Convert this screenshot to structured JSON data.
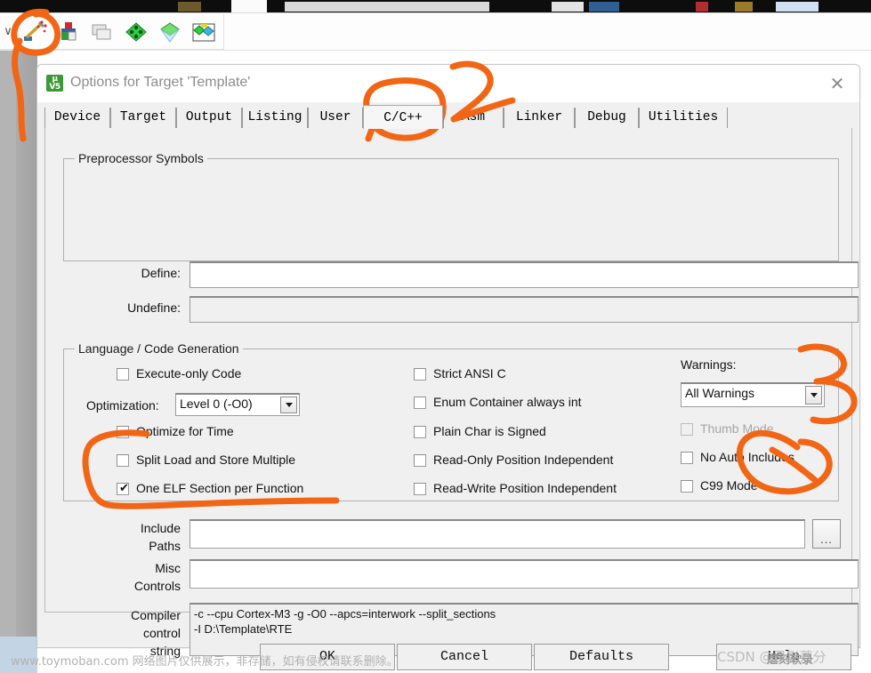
{
  "window": {
    "title": "Options for Target 'Template'",
    "icon_line1": "μ",
    "icon_line2": "V5",
    "close_label": "✕"
  },
  "toolbar": {
    "chevron": "∨",
    "icons": [
      {
        "name": "rebuild-target-icon",
        "label": "rebuild"
      },
      {
        "name": "batch-build-icon",
        "label": "batch build"
      },
      {
        "name": "stop-build-icon",
        "label": "stop build"
      },
      {
        "name": "options-for-target-icon",
        "label": "options for target"
      },
      {
        "name": "manage-project-items-icon",
        "label": "manage project items"
      },
      {
        "name": "manage-runtime-environment-icon",
        "label": "manage run-time environment"
      }
    ]
  },
  "tabs": [
    {
      "label": "Device",
      "selected": false
    },
    {
      "label": "Target",
      "selected": false
    },
    {
      "label": "Output",
      "selected": false
    },
    {
      "label": "Listing",
      "selected": false
    },
    {
      "label": "User",
      "selected": false
    },
    {
      "label": "C/C++",
      "selected": true
    },
    {
      "label": "Asm",
      "selected": false
    },
    {
      "label": "Linker",
      "selected": false
    },
    {
      "label": "Debug",
      "selected": false
    },
    {
      "label": "Utilities",
      "selected": false
    }
  ],
  "preprocessor": {
    "legend": "Preprocessor Symbols",
    "define_label": "Define:",
    "define_value": "",
    "define_placeholder": "",
    "undefine_label": "Undefine:",
    "undefine_value": "",
    "undefine_placeholder": ""
  },
  "language": {
    "legend": "Language / Code Generation",
    "col1": [
      {
        "label": "Execute-only Code",
        "checked": false,
        "enabled": true
      },
      {
        "label": "Optimize for Time",
        "checked": false,
        "enabled": true
      },
      {
        "label": "Split Load and Store Multiple",
        "checked": false,
        "enabled": true
      },
      {
        "label": "One ELF Section per Function",
        "checked": true,
        "enabled": true
      }
    ],
    "optimization_label": "Optimization:",
    "optimization_value": "Level 0 (-O0)",
    "col2": [
      {
        "label": "Strict ANSI C",
        "checked": false,
        "enabled": true
      },
      {
        "label": "Enum Container always int",
        "checked": false,
        "enabled": true
      },
      {
        "label": "Plain Char is Signed",
        "checked": false,
        "enabled": true
      },
      {
        "label": "Read-Only Position Independent",
        "checked": false,
        "enabled": true
      },
      {
        "label": "Read-Write Position Independent",
        "checked": false,
        "enabled": true
      }
    ],
    "warnings_label": "Warnings:",
    "warnings_value": "All Warnings",
    "col3": [
      {
        "label": "Thumb Mode",
        "checked": false,
        "enabled": false
      },
      {
        "label": "No Auto Includes",
        "checked": false,
        "enabled": true
      },
      {
        "label": "C99 Mode",
        "checked": false,
        "enabled": true
      }
    ],
    "checkmark": "✔"
  },
  "paths": {
    "include_label_l1": "Include",
    "include_label_l2": "Paths",
    "include_value": "",
    "browse_label": "...",
    "misc_label_l1": "Misc",
    "misc_label_l2": "Controls",
    "misc_value": "",
    "compiler_label_l1": "Compiler",
    "compiler_label_l2": "control",
    "compiler_label_l3": "string",
    "compiler_value": "-c --cpu Cortex-M3 -g -O0 --apcs=interwork --split_sections\n-I D:\\Template\\RTE"
  },
  "buttons": {
    "ok": "OK",
    "cancel": "Cancel",
    "defaults": "Defaults",
    "help": "Help"
  },
  "annotations": {
    "marker_color": "#F26515",
    "label_2": "2",
    "label_3": "3"
  },
  "watermarks": {
    "bottom": "www.toymoban.com 网络图片仅供展示，非存储，如有侵权请联系删除。",
    "csdn": "CSDN @黑影荔分",
    "csdn_overlay": "虐刻软录"
  }
}
